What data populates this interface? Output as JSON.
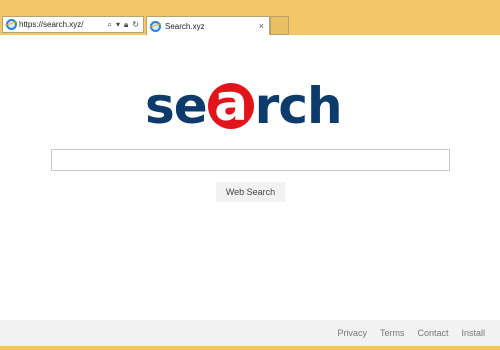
{
  "browser": {
    "address_url": "https://search.xyz/",
    "icons": [
      "ie-icon",
      "search-icon",
      "dropdown-icon",
      "lock-icon",
      "refresh-icon",
      "close-icon"
    ],
    "tab": {
      "title": "Search.xyz",
      "close_glyph": "×"
    }
  },
  "logo": {
    "prefix": "se",
    "circle_letter": "a",
    "suffix": "rch",
    "colors": {
      "text": "#0c3b6c",
      "circle": "#e1141c"
    }
  },
  "search": {
    "input_value": "",
    "button_label": "Web Search"
  },
  "footer": {
    "links": [
      "Privacy",
      "Terms",
      "Contact",
      "Install"
    ]
  }
}
